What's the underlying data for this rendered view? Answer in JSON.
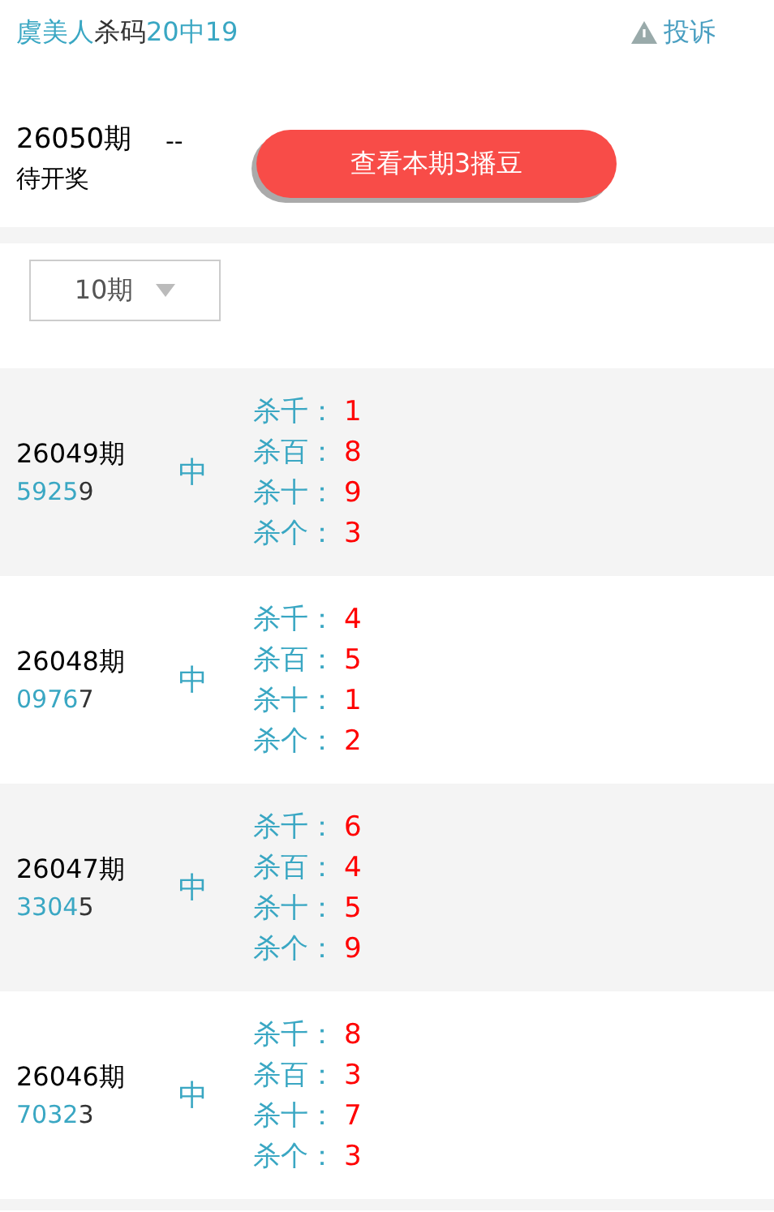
{
  "header": {
    "author": "虞美人",
    "label": "杀码",
    "record": "20中19",
    "complaint": "投诉"
  },
  "current": {
    "issue": "26050期",
    "status": "待开奖",
    "value": "--",
    "button": "查看本期3播豆"
  },
  "filter": {
    "value": "10期"
  },
  "rows": [
    {
      "issue": "26049期",
      "number_head": "5925",
      "number_tail": "9",
      "result": "中",
      "kills": [
        {
          "label": "杀千：",
          "value": "1"
        },
        {
          "label": "杀百：",
          "value": "8"
        },
        {
          "label": "杀十：",
          "value": "9"
        },
        {
          "label": "杀个：",
          "value": "3"
        }
      ]
    },
    {
      "issue": "26048期",
      "number_head": "0976",
      "number_tail": "7",
      "result": "中",
      "kills": [
        {
          "label": "杀千：",
          "value": "4"
        },
        {
          "label": "杀百：",
          "value": "5"
        },
        {
          "label": "杀十：",
          "value": "1"
        },
        {
          "label": "杀个：",
          "value": "2"
        }
      ]
    },
    {
      "issue": "26047期",
      "number_head": "3304",
      "number_tail": "5",
      "result": "中",
      "kills": [
        {
          "label": "杀千：",
          "value": "6"
        },
        {
          "label": "杀百：",
          "value": "4"
        },
        {
          "label": "杀十：",
          "value": "5"
        },
        {
          "label": "杀个：",
          "value": "9"
        }
      ]
    },
    {
      "issue": "26046期",
      "number_head": "7032",
      "number_tail": "3",
      "result": "中",
      "kills": [
        {
          "label": "杀千：",
          "value": "8"
        },
        {
          "label": "杀百：",
          "value": "3"
        },
        {
          "label": "杀十：",
          "value": "7"
        },
        {
          "label": "杀个：",
          "value": "3"
        }
      ]
    }
  ]
}
